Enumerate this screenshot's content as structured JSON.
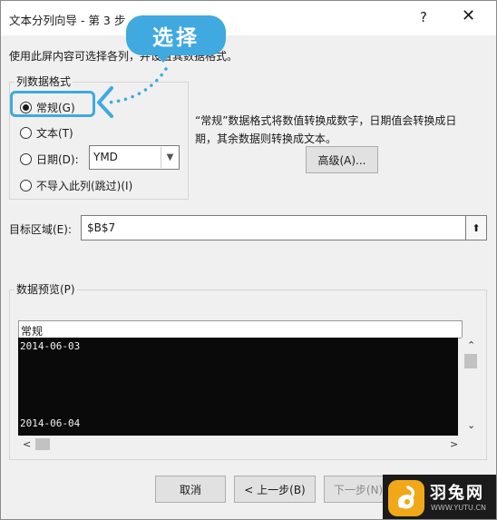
{
  "dialog": {
    "title": "文本分列向导 - 第 3 步",
    "help_label": "?",
    "close_label": "✕",
    "description": "使用此屏内容可选择各列，并设置其数据格式。"
  },
  "column_format": {
    "group_label": "列数据格式",
    "options": [
      {
        "label": "常规(G)",
        "selected": true
      },
      {
        "label": "文本(T)",
        "selected": false
      },
      {
        "label": "日期(D):",
        "selected": false
      },
      {
        "label": "不导入此列(跳过)(I)",
        "selected": false
      }
    ],
    "date_format_value": "YMD",
    "hint_line1": "“常规”数据格式将数值转换成数字，日期值会转换成日",
    "hint_line2": "期，其余数据则转换成文本。",
    "advanced_button": "高级(A)..."
  },
  "destination": {
    "label": "目标区域(E):",
    "value": "$B$7"
  },
  "preview": {
    "group_label": "数据预览(P)",
    "column_header": "常规",
    "rows": [
      "2014-06-03",
      "2014-06-04"
    ]
  },
  "footer": {
    "cancel_button": "取消",
    "back_button": "< 上一步(B)",
    "next_button": "下一步(N) >"
  },
  "annotation": {
    "callout_text": "选择",
    "color": "#3fa9e0"
  },
  "watermark": {
    "title": "羽兔网",
    "url": "WWW.YUTU.CN"
  }
}
